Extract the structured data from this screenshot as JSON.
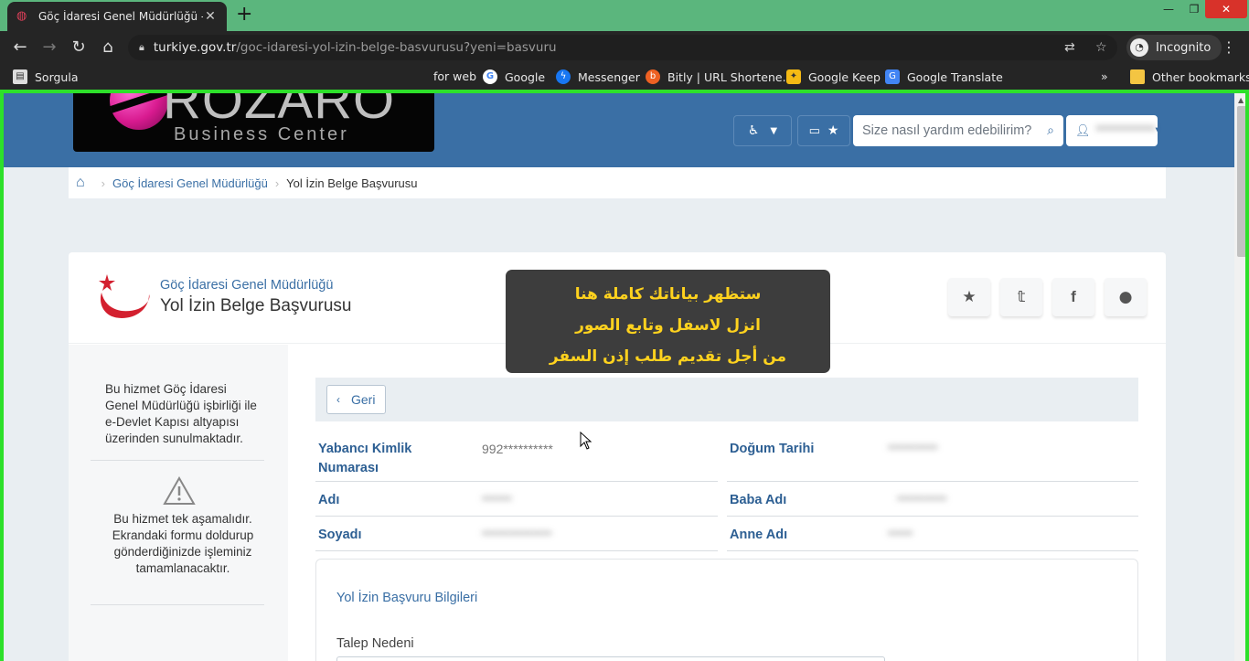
{
  "browser": {
    "tab_title": "Göç İdaresi Genel Müdürlüğü - Y",
    "url_host": "turkiye.gov.tr",
    "url_path": "/goc-idaresi-yol-izin-belge-basvurusu?yeni=basvuru",
    "profile_label": "Incognito",
    "bookmarks": [
      {
        "label": "Sorgula"
      },
      {
        "label": "for web"
      },
      {
        "label": "Google"
      },
      {
        "label": "Messenger"
      },
      {
        "label": "Bitly | URL Shortene..."
      },
      {
        "label": "Google Keep"
      },
      {
        "label": "Google Translate"
      }
    ],
    "more_bookmarks": "»",
    "other_bookmarks": "Other bookmarks"
  },
  "logo": {
    "text": "ROZARO",
    "subtitle": "Business Center"
  },
  "header": {
    "search_placeholder": "Size nasıl yardım edebilirim?",
    "user_name": "**********"
  },
  "breadcrumb": {
    "org": "Göç İdaresi Genel Müdürlüğü",
    "current": "Yol İzin Belge Başvurusu"
  },
  "service": {
    "org": "Göç İdaresi Genel Müdürlüğü",
    "title": "Yol İzin Belge Başvurusu"
  },
  "sidebar": {
    "info_text": "Bu hizmet Göç İdaresi Genel Müdürlüğü işbirliği ile e-Devlet Kapısı altyapısı üzerinden sunulmaktadır.",
    "step_text": "Bu hizmet tek aşamalıdır. Ekrandaki formu doldurup gönderdiğinizde işleminiz tamamlanacaktır."
  },
  "main": {
    "back_label": "Geri",
    "fields": [
      {
        "label": "Yabancı Kimlik Numarası",
        "value": "992**********"
      },
      {
        "label": "Doğum Tarihi",
        "value": "**********"
      },
      {
        "label": "Adı",
        "value": "******"
      },
      {
        "label": "Baba Adı",
        "value": "**********"
      },
      {
        "label": "Soyadı",
        "value": "**************"
      },
      {
        "label": "Anne Adı",
        "value": "*****"
      }
    ],
    "form_title": "Yol İzin Başvuru Bilgileri",
    "form_field_label": "Talep Nedeni"
  },
  "overlay": {
    "lines": [
      "ستظهر بياناتك كاملة هنا",
      "انزل لاسفل وتابع الصور",
      "من أجل تقديم طلب إذن السفر"
    ]
  }
}
